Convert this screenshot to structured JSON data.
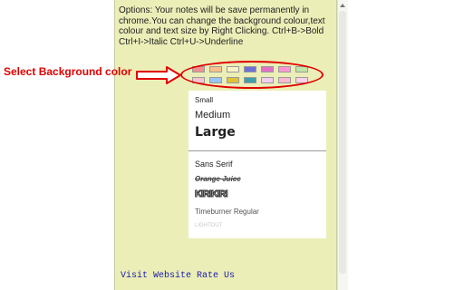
{
  "options_text": "Options: Your notes will be save permanently in chrome.You can change the background colour,text colour and text size by Right Clicking. Ctrl+B->Bold Ctrl+I->Italic Ctrl+U->Underline",
  "annotation": {
    "label": "Select Background color",
    "color": "#e00000"
  },
  "panel": {
    "background": "#ebeeb7"
  },
  "color_swatches": [
    [
      "#f08f8f",
      "#f5c08a",
      "#f7f3c4",
      "#6f6fd8",
      "#e270c7",
      "#ff95d0",
      "#bfe6a6"
    ],
    [
      "#f7c5d0",
      "#99c6f2",
      "#e0c236",
      "#3f9fa8",
      "#f2cdf0",
      "#fdb7cf",
      "#fbd1e9"
    ]
  ],
  "size_menu": {
    "small": "Small",
    "medium": "Medium",
    "large": "Large"
  },
  "font_menu": {
    "sans_serif": "Sans Serif",
    "orange_juice": "Orange Juice",
    "decorative_font": "KIRIKIRI",
    "timeburner": "Timeburner Regular",
    "faint_font": "LIGHTOUT"
  },
  "footer": {
    "visit_website": "Visit Website",
    "rate_us": "Rate Us"
  }
}
